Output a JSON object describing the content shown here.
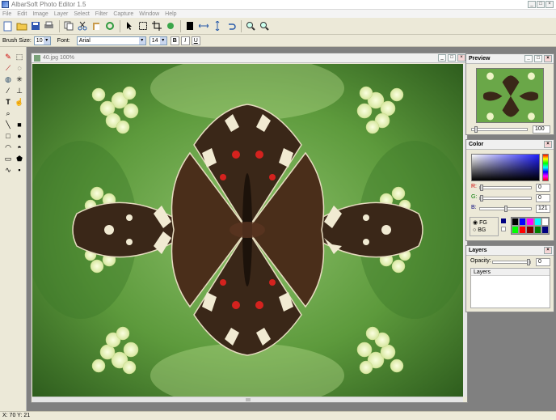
{
  "window": {
    "title": "AlbarSoft Photo Editor 1.5",
    "min": "_",
    "max": "□",
    "close": "×"
  },
  "menu": [
    "File",
    "Edit",
    "Image",
    "Layer",
    "Select",
    "Filter",
    "Capture",
    "Window",
    "Help"
  ],
  "options": {
    "brush_size_label": "Brush Size:",
    "brush_size_value": "10",
    "font_label": "Font:",
    "font_value": "Arial",
    "font_size_value": "14",
    "bold": "B",
    "italic": "I",
    "underline": "U"
  },
  "document": {
    "title": "40.jpg 100%"
  },
  "preview": {
    "title": "Preview",
    "zoom_value": "100"
  },
  "color": {
    "title": "Color",
    "r_label": "R:",
    "r_value": "0",
    "g_label": "G:",
    "g_value": "0",
    "b_label": "B:",
    "b_value": "121",
    "fg_label": "FG",
    "bg_label": "BG",
    "swatches": [
      "#000000",
      "#0000ff",
      "#ff00ff",
      "#00ffff",
      "#ffffff",
      "#00ff00",
      "#ff0000",
      "#800000",
      "#008000",
      "#000080"
    ]
  },
  "layers": {
    "title": "Layers",
    "opacity_label": "Opacity:",
    "opacity_value": "0",
    "list_header": "Layers"
  },
  "status": {
    "coords": "X: 70 Y: 21"
  }
}
